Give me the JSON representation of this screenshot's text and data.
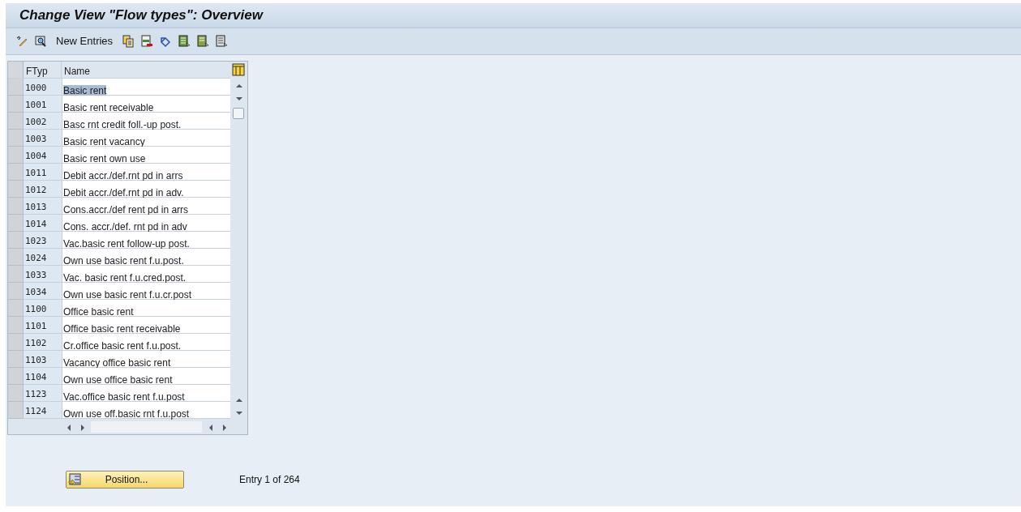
{
  "window": {
    "title": "Change View \"Flow types\": Overview"
  },
  "toolbar": {
    "new_entries": "New Entries"
  },
  "table": {
    "columns": [
      "FTyp",
      "Name"
    ],
    "rows": [
      {
        "ftyp": "1000",
        "name": "Basic rent",
        "selected": true
      },
      {
        "ftyp": "1001",
        "name": "Basic rent receivable",
        "selected": false
      },
      {
        "ftyp": "1002",
        "name": "Basc rnt credit foll.-up post.",
        "selected": false
      },
      {
        "ftyp": "1003",
        "name": "Basic rent vacancy",
        "selected": false
      },
      {
        "ftyp": "1004",
        "name": "Basic rent own use",
        "selected": false
      },
      {
        "ftyp": "1011",
        "name": "Debit accr./def.rnt pd in arrs",
        "selected": false
      },
      {
        "ftyp": "1012",
        "name": "Debit accr./def.rnt pd in adv.",
        "selected": false
      },
      {
        "ftyp": "1013",
        "name": "Cons.accr./def rent pd in arrs",
        "selected": false
      },
      {
        "ftyp": "1014",
        "name": "Cons. accr./def. rnt pd in adv",
        "selected": false
      },
      {
        "ftyp": "1023",
        "name": "Vac.basic rent follow-up post.",
        "selected": false
      },
      {
        "ftyp": "1024",
        "name": "Own use basic rent f.u.post.",
        "selected": false
      },
      {
        "ftyp": "1033",
        "name": "Vac. basic rent f.u.cred.post.",
        "selected": false
      },
      {
        "ftyp": "1034",
        "name": "Own use basic rent f.u.cr.post",
        "selected": false
      },
      {
        "ftyp": "1100",
        "name": "Office basic rent",
        "selected": false
      },
      {
        "ftyp": "1101",
        "name": "Office basic rent receivable",
        "selected": false
      },
      {
        "ftyp": "1102",
        "name": "Cr.office basic rent f.u.post.",
        "selected": false
      },
      {
        "ftyp": "1103",
        "name": "Vacancy office basic rent",
        "selected": false
      },
      {
        "ftyp": "1104",
        "name": "Own use office basic rent",
        "selected": false
      },
      {
        "ftyp": "1123",
        "name": "Vac.office basic rent f.u.post",
        "selected": false
      },
      {
        "ftyp": "1124",
        "name": "Own use off.basic rnt f.u.post",
        "selected": false
      }
    ]
  },
  "footer": {
    "position_button": "Position...",
    "entry_info": "Entry 1 of 264"
  }
}
